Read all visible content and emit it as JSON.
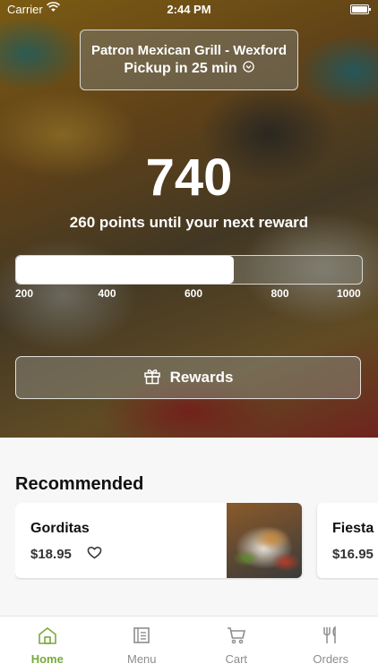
{
  "status_bar": {
    "carrier": "Carrier",
    "time": "2:44 PM"
  },
  "location": {
    "name": "Patron Mexican Grill - Wexford",
    "pickup": "Pickup in 25 min",
    "icon": "chevron-down-circle-icon"
  },
  "rewards": {
    "points": "740",
    "subtitle": "260 points until your next reward",
    "progress_fraction": 0.63,
    "ticks": [
      "200",
      "400",
      "600",
      "800",
      "1000"
    ],
    "button_label": "Rewards",
    "button_icon": "gift-icon"
  },
  "recommended": {
    "title": "Recommended",
    "items": [
      {
        "name": "Gorditas",
        "price": "$18.95",
        "icon": "heart-icon"
      },
      {
        "name": "Fiesta",
        "price": "$16.95"
      }
    ]
  },
  "tab_bar": {
    "tabs": [
      {
        "label": "Home",
        "icon": "home-icon",
        "active": true
      },
      {
        "label": "Menu",
        "icon": "menu-icon",
        "active": false
      },
      {
        "label": "Cart",
        "icon": "cart-icon",
        "active": false
      },
      {
        "label": "Orders",
        "icon": "fork-knife-icon",
        "active": false
      }
    ]
  },
  "colors": {
    "accent": "#7aa93c",
    "inactive": "#8d8d8d"
  }
}
